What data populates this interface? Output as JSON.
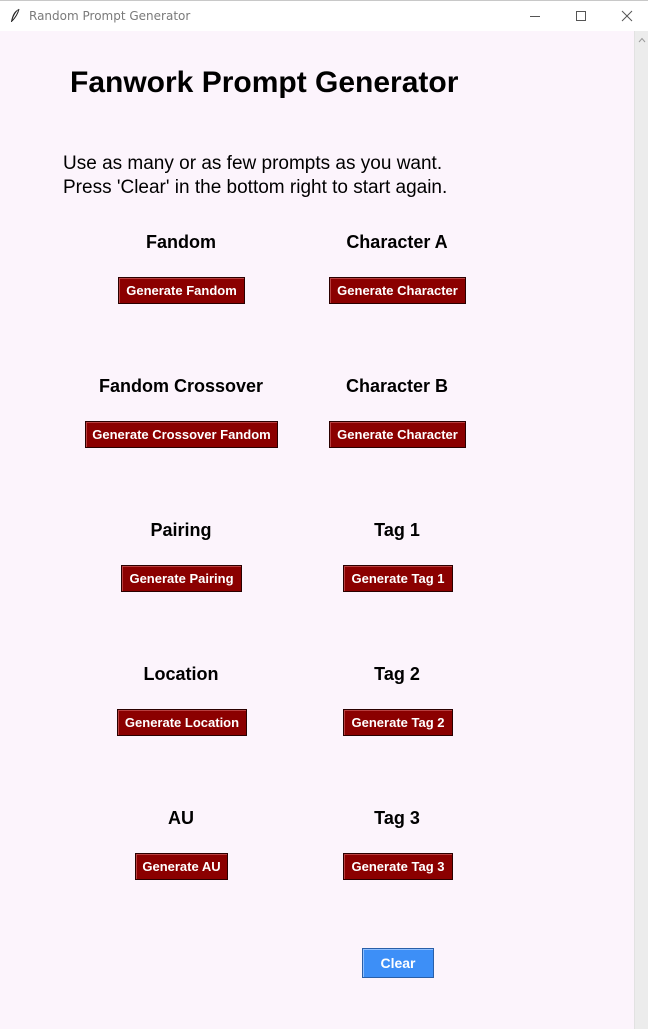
{
  "window": {
    "title": "Random Prompt Generator"
  },
  "main": {
    "heading": "Fanwork Prompt Generator",
    "instructions": [
      "Use as many or as few prompts as you want.",
      "Press 'Clear' in the bottom right to start again."
    ],
    "sections": [
      {
        "label": "Fandom",
        "button": "Generate Fandom"
      },
      {
        "label": "Character A",
        "button": "Generate Character"
      },
      {
        "label": "Fandom Crossover",
        "button": "Generate Crossover Fandom"
      },
      {
        "label": "Character B",
        "button": "Generate Character"
      },
      {
        "label": "Pairing",
        "button": "Generate Pairing"
      },
      {
        "label": "Tag 1",
        "button": "Generate Tag 1"
      },
      {
        "label": "Location",
        "button": "Generate Location"
      },
      {
        "label": "Tag 2",
        "button": "Generate Tag 2"
      },
      {
        "label": "AU",
        "button": "Generate AU"
      },
      {
        "label": "Tag 3",
        "button": "Generate Tag 3"
      }
    ],
    "clear_label": "Clear"
  },
  "colors": {
    "background": "#fcf4fc",
    "generate_button": "#8b0000",
    "clear_button": "#3d8ff7"
  },
  "icons": {
    "app": "feather-icon",
    "minimize": "minimize-icon",
    "maximize": "maximize-icon",
    "close": "close-icon"
  }
}
